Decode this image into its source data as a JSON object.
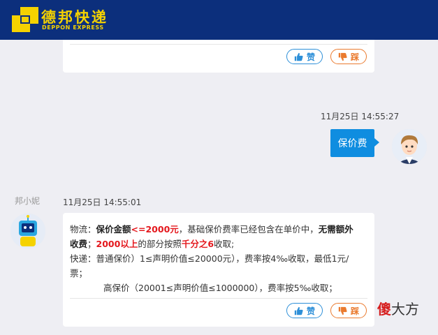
{
  "brand": {
    "name_cn": "德邦快递",
    "name_en": "DEPPON EXPRESS",
    "color_primary": "#0c2f7c",
    "color_logo": "#f5d200"
  },
  "feedback": {
    "like_label": "赞",
    "dislike_label": "踩",
    "like_icon": "thumbs-up-icon",
    "dislike_icon": "thumbs-down-icon"
  },
  "user_message": {
    "timestamp": "11月25日 14:55:27",
    "text": "保价费"
  },
  "agent_message": {
    "agent_name": "邦小妮",
    "timestamp": "11月25日 14:55:01",
    "p1": {
      "a": "物流：",
      "b": "保价金额",
      "c": "<=2000元",
      "d": "，基础保价费率已经包含在单价中，",
      "e": "无需额外收费",
      "f": "；",
      "g": "2000以上",
      "h": "的部分按照",
      "i": "千分之6",
      "j": "收取;"
    },
    "line2": "快递：普通保价）1≤声明价值≤20000元），费率按4‰收取，最低1元/票；",
    "line3": "高保价（20001≤声明价值≤1000000），费率按5‰收取；"
  },
  "watermark": {
    "w1": "傻",
    "w2": "大方"
  }
}
